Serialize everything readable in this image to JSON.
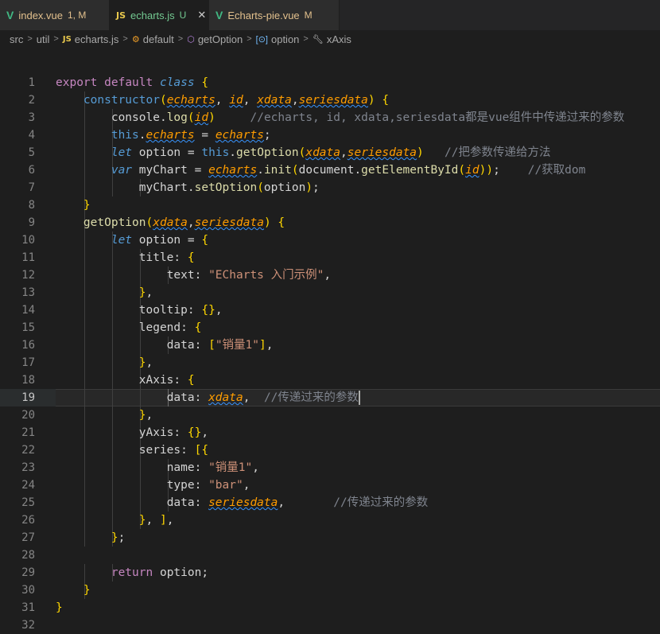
{
  "tabs": [
    {
      "icon": "V",
      "name": "index.vue",
      "badge": "1, M",
      "active": false
    },
    {
      "icon": "JS",
      "name": "echarts.js",
      "badge": "U",
      "active": true
    },
    {
      "icon": "V",
      "name": "Echarts-pie.vue",
      "badge": "M",
      "active": false
    }
  ],
  "breadcrumb": {
    "src": "src",
    "util": "util",
    "file_icon": "JS",
    "file": "echarts.js",
    "cls": "default",
    "method": "getOption",
    "var": "option",
    "prop": "xAxis"
  },
  "editor": {
    "current_line": 19,
    "line_numbers": [
      "1",
      "2",
      "3",
      "4",
      "5",
      "6",
      "7",
      "8",
      "9",
      "10",
      "11",
      "12",
      "13",
      "14",
      "15",
      "16",
      "17",
      "18",
      "19",
      "20",
      "21",
      "22",
      "23",
      "24",
      "25",
      "26",
      "27",
      "28",
      "29",
      "30",
      "31",
      "32"
    ],
    "lines": [
      "export default class {",
      "    constructor(echarts, id, xdata,seriesdata) {",
      "        console.log(id)     //echarts, id, xdata,seriesdata都是vue组件中传递过来的参数",
      "        this.echarts = echarts;",
      "        let option = this.getOption(xdata,seriesdata)   //把参数传递给方法",
      "        var myChart = echarts.init(document.getElementById(id));    //获取dom",
      "            myChart.setOption(option);",
      "    }",
      "    getOption(xdata,seriesdata) {",
      "        let option = {",
      "            title: {",
      "                text: \"ECharts 入门示例\",",
      "            },",
      "            tooltip: {},",
      "            legend: {",
      "                data: [\"销量1\"],",
      "            },",
      "            xAxis: {",
      "                data: xdata,  //传递过来的参数",
      "            },",
      "            yAxis: {},",
      "            series: [{",
      "                name: \"销量1\",",
      "                type: \"bar\",",
      "                data: seriesdata,       //传递过来的参数",
      "            }, ],",
      "        };",
      "",
      "        return option;",
      "    }",
      "}",
      ""
    ]
  }
}
